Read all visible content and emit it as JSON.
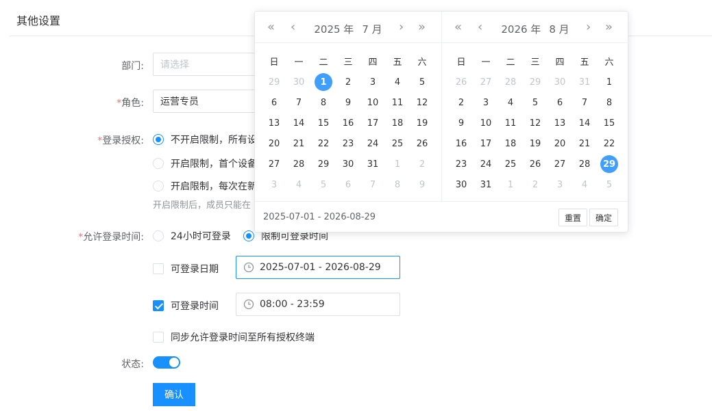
{
  "section": {
    "title": "其他设置"
  },
  "form": {
    "dept": {
      "label": "部门:",
      "placeholder": "请选择"
    },
    "role": {
      "required": "*",
      "label": "角色:",
      "value": "运营专员"
    },
    "auth": {
      "required": "*",
      "label": "登录授权:",
      "options": [
        "不开启限制，所有设",
        "开启限制，首个设备",
        "开启限制，每次在新"
      ],
      "selected_index": 0,
      "hint": "开启限制后，成员只能在"
    },
    "login_time": {
      "required": "*",
      "label": "允许登录时间:",
      "options": [
        "24小时可登录",
        "限制可登录时间"
      ],
      "selected_index": 1
    },
    "date_range": {
      "label": "可登录日期",
      "checked": false,
      "value": "2025-07-01 - 2026-08-29"
    },
    "time_range": {
      "label": "可登录时间",
      "checked": true,
      "value": "08:00 - 23:59"
    },
    "sync": {
      "label": "同步允许登录时间至所有授权终端",
      "checked": false
    },
    "status": {
      "label": "状态:",
      "on": true
    },
    "confirm_label": "确认"
  },
  "picker": {
    "left": {
      "year": "2025 年",
      "month": "7 月"
    },
    "right": {
      "year": "2026 年",
      "month": "8 月"
    },
    "weekdays": [
      "日",
      "一",
      "二",
      "三",
      "四",
      "五",
      "六"
    ],
    "left_days": [
      [
        "29",
        "m"
      ],
      [
        "30",
        "m"
      ],
      [
        "1",
        "s"
      ],
      [
        "2",
        ""
      ],
      [
        "3",
        ""
      ],
      [
        "4",
        ""
      ],
      [
        "5",
        ""
      ],
      [
        "6",
        ""
      ],
      [
        "7",
        ""
      ],
      [
        "8",
        ""
      ],
      [
        "9",
        ""
      ],
      [
        "10",
        ""
      ],
      [
        "11",
        ""
      ],
      [
        "12",
        ""
      ],
      [
        "13",
        ""
      ],
      [
        "14",
        ""
      ],
      [
        "15",
        ""
      ],
      [
        "16",
        ""
      ],
      [
        "17",
        ""
      ],
      [
        "18",
        ""
      ],
      [
        "19",
        ""
      ],
      [
        "20",
        ""
      ],
      [
        "21",
        ""
      ],
      [
        "22",
        ""
      ],
      [
        "23",
        ""
      ],
      [
        "24",
        ""
      ],
      [
        "25",
        ""
      ],
      [
        "26",
        ""
      ],
      [
        "27",
        ""
      ],
      [
        "28",
        ""
      ],
      [
        "29",
        ""
      ],
      [
        "30",
        ""
      ],
      [
        "31",
        ""
      ],
      [
        "1",
        "m"
      ],
      [
        "2",
        "m"
      ],
      [
        "3",
        "m"
      ],
      [
        "4",
        "m"
      ],
      [
        "5",
        "m"
      ],
      [
        "6",
        "m"
      ],
      [
        "7",
        "m"
      ],
      [
        "8",
        "m"
      ],
      [
        "9",
        "m"
      ]
    ],
    "right_days": [
      [
        "26",
        "m"
      ],
      [
        "27",
        "m"
      ],
      [
        "28",
        "m"
      ],
      [
        "29",
        "m"
      ],
      [
        "30",
        "m"
      ],
      [
        "31",
        "m"
      ],
      [
        "1",
        ""
      ],
      [
        "2",
        ""
      ],
      [
        "3",
        ""
      ],
      [
        "4",
        ""
      ],
      [
        "5",
        ""
      ],
      [
        "6",
        ""
      ],
      [
        "7",
        ""
      ],
      [
        "8",
        ""
      ],
      [
        "9",
        ""
      ],
      [
        "10",
        ""
      ],
      [
        "11",
        ""
      ],
      [
        "12",
        ""
      ],
      [
        "13",
        ""
      ],
      [
        "14",
        ""
      ],
      [
        "15",
        ""
      ],
      [
        "16",
        ""
      ],
      [
        "17",
        ""
      ],
      [
        "18",
        ""
      ],
      [
        "19",
        ""
      ],
      [
        "20",
        ""
      ],
      [
        "21",
        ""
      ],
      [
        "22",
        ""
      ],
      [
        "23",
        ""
      ],
      [
        "24",
        ""
      ],
      [
        "25",
        ""
      ],
      [
        "26",
        ""
      ],
      [
        "27",
        ""
      ],
      [
        "28",
        ""
      ],
      [
        "29",
        "s"
      ],
      [
        "30",
        ""
      ],
      [
        "31",
        ""
      ],
      [
        "1",
        "m"
      ],
      [
        "2",
        "m"
      ],
      [
        "3",
        "m"
      ],
      [
        "4",
        "m"
      ],
      [
        "5",
        "m"
      ]
    ],
    "range_text": "2025-07-01 - 2026-08-29",
    "reset_label": "重置",
    "ok_label": "确定"
  },
  "colors": {
    "accent": "#1890ff",
    "selected_day": "#409eff",
    "required": "#f56c6c"
  }
}
